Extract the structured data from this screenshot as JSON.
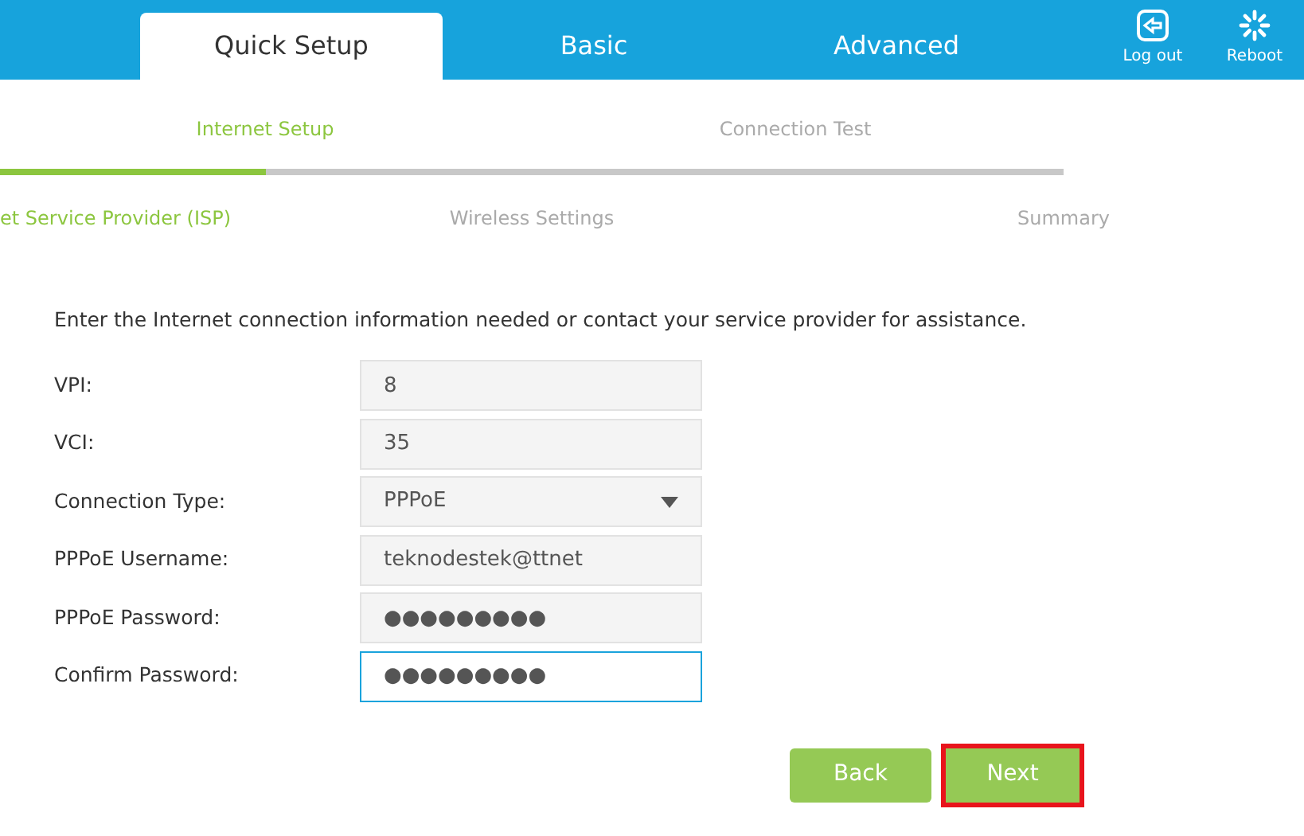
{
  "top_tabs": [
    {
      "label": "Quick Setup",
      "selected": true
    },
    {
      "label": "Basic",
      "selected": false
    },
    {
      "label": "Advanced",
      "selected": false
    }
  ],
  "top_actions": [
    {
      "kind": "logout",
      "label": "Log out"
    },
    {
      "kind": "reboot",
      "label": "Reboot"
    }
  ],
  "steps": [
    {
      "label": "Internet Setup",
      "selected": true
    },
    {
      "label": "Connection Test",
      "selected": false
    }
  ],
  "progress": {
    "level": 0.25
  },
  "substeps": [
    {
      "label": "et Service Provider (ISP)",
      "selected": true
    },
    {
      "label": "Wireless Settings",
      "selected": false
    },
    {
      "label": "Summary",
      "selected": false
    }
  ],
  "intro": "Enter the Internet connection information needed or contact your service provider for assistance.",
  "fields": [
    {
      "kind": "text",
      "label": "VPI:",
      "value": "8",
      "focused": false
    },
    {
      "kind": "text",
      "label": "VCI:",
      "value": "35",
      "focused": false
    },
    {
      "kind": "select",
      "label": "Connection Type:",
      "value": "PPPoE",
      "focused": false
    },
    {
      "kind": "text",
      "label": "PPPoE Username:",
      "value": "teknodestek@ttnet",
      "focused": false
    },
    {
      "kind": "text",
      "label": "PPPoE Password:",
      "value": "●●●●●●●●●",
      "focused": false
    },
    {
      "kind": "text",
      "label": "Confirm Password:",
      "value": "●●●●●●●●●",
      "focused": true
    }
  ],
  "buttons": [
    {
      "label": "Back",
      "highlighted": false
    },
    {
      "label": "Next",
      "highlighted": true
    }
  ]
}
